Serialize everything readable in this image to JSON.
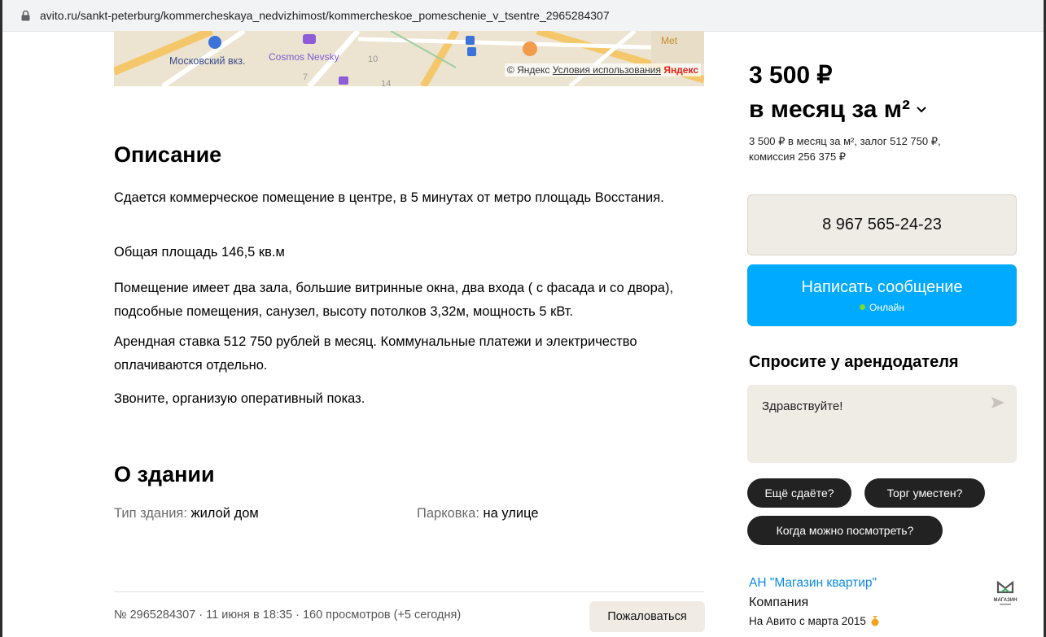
{
  "browser": {
    "url": "avito.ru/sankt-peterburg/kommercheskaya_nedvizhimost/kommercheskoe_pomeschenie_v_tsentre_2965284307"
  },
  "map": {
    "labels": {
      "station": "Московский вкз.",
      "hotel": "Cosmos Nevsky",
      "metro": "Met",
      "n10": "10",
      "n7": "7",
      "n14": "14"
    },
    "copyright": "© Яндекс",
    "terms_link": "Условия использования",
    "brand": "Яндекс"
  },
  "description": {
    "heading": "Описание",
    "paragraphs": [
      "Сдается коммерческое помещение в центре, в 5 минутах от метро площадь Восстания.",
      "Общая площадь 146,5 кв.м",
      "Помещение имеет два зала, большие витринные окна, два входа ( с фасада и со двора), подсобные помещения, санузел, высоту потолков 3,32м, мощность 5 кВт.",
      "Арендная ставка 512 750 рублей в месяц. Коммунальные платежи и электричество оплачиваются отдельно.",
      "Звоните, организую оперативный показ."
    ]
  },
  "building": {
    "heading": "О здании",
    "type_label": "Тип здания:",
    "type_value": "жилой дом",
    "parking_label": "Парковка:",
    "parking_value": "на улице"
  },
  "footer": {
    "meta": "№ 2965284307 · 11 июня в 18:35 · 160 просмотров (+5 сегодня)",
    "report_label": "Пожаловаться"
  },
  "price": {
    "line1": "3 500 ₽",
    "line2": "в месяц за м²",
    "details_line1": "3 500 ₽ в месяц за м², залог 512 750 ₽,",
    "details_line2": "комиссия 256 375 ₽"
  },
  "contact": {
    "phone": "8 967 565-24-23",
    "message_label": "Написать сообщение",
    "online_label": "Онлайн"
  },
  "ask": {
    "title": "Спросите у арендодателя",
    "input_value": "Здравствуйте!",
    "chips": [
      "Ещё сдаёте?",
      "Торг уместен?",
      "Когда можно посмотреть?"
    ]
  },
  "seller": {
    "name": "АН \"Магазин квартир\"",
    "type": "Компания",
    "since": "На Авито с марта 2015",
    "logo_text": "МАГАЗИН"
  }
}
